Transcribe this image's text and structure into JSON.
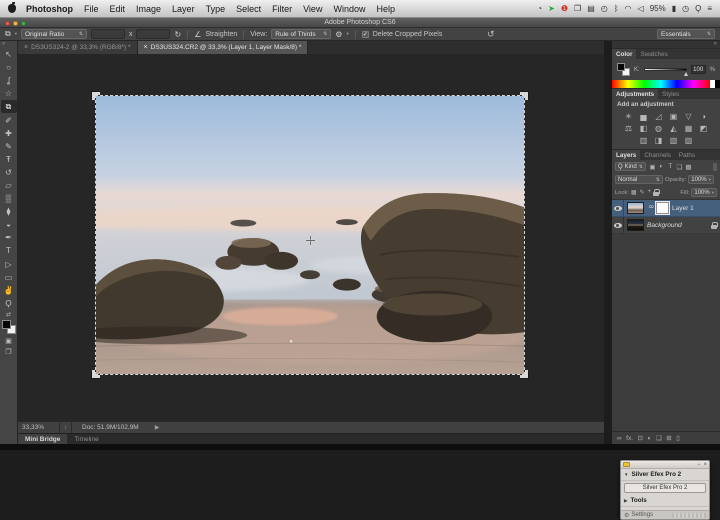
{
  "colors": {
    "selection_blue": "#44607c",
    "badge_red": "#cf3126",
    "vpn_green": "#23a63c",
    "traffic_red": "#f25c54",
    "traffic_yellow": "#f8bd44",
    "traffic_green": "#3fb94f"
  },
  "menubar": {
    "items": [
      {
        "label": "Photoshop",
        "active": true
      },
      {
        "label": "File"
      },
      {
        "label": "Edit"
      },
      {
        "label": "Image"
      },
      {
        "label": "Layer"
      },
      {
        "label": "Type"
      },
      {
        "label": "Select"
      },
      {
        "label": "Filter"
      },
      {
        "label": "View"
      },
      {
        "label": "Window"
      },
      {
        "label": "Help"
      }
    ],
    "status_icons": [
      {
        "name": "compass-icon",
        "glyph": "◔"
      },
      {
        "name": "vpn-arrow-icon",
        "glyph": "➤",
        "color": "#23a63c"
      },
      {
        "name": "update-badge-icon",
        "glyph": "❶",
        "color": "#cf3126"
      },
      {
        "name": "stack-icon",
        "glyph": "❐"
      },
      {
        "name": "display-icon",
        "glyph": "▤"
      },
      {
        "name": "time-machine-icon",
        "glyph": "◴"
      },
      {
        "name": "bluetooth-icon",
        "glyph": "ᛒ"
      },
      {
        "name": "wifi-icon",
        "glyph": "◠"
      },
      {
        "name": "volume-icon",
        "glyph": "◁"
      },
      {
        "name": "battery-percent-label",
        "glyph": "95%"
      },
      {
        "name": "battery-icon",
        "glyph": "▮"
      },
      {
        "name": "clock-icon",
        "glyph": "◷"
      },
      {
        "name": "spotlight-icon",
        "glyph": "Ϙ"
      },
      {
        "name": "notification-list-icon",
        "glyph": "≡"
      }
    ]
  },
  "titlebar": {
    "title": "Adobe Photoshop CS6"
  },
  "options": {
    "crop_icon": "⧉",
    "ratio_value": "Original Ratio",
    "x_label": "x",
    "swap_icon": "↻",
    "straighten_icon": "∠",
    "straighten_label": "Straighten",
    "view_label": "View:",
    "view_value": "Rule of Thirds",
    "gear_icon": "⚙",
    "delete_label": "Delete Cropped Pixels",
    "check_glyph": "✓",
    "reset_icon": "↺",
    "workspace_value": "Essentials"
  },
  "dock_collapse_icon": "»",
  "doc_tabs": [
    {
      "label": "DS3US324-2 @ 33,3% (RGB/8*) *"
    },
    {
      "label": "DS3US324.CR2 @ 33,3% (Layer 1, Layer Mask/8) *",
      "active": true
    }
  ],
  "tab_close_icon": "×",
  "tools": [
    {
      "name": "move-tool",
      "glyph": "↖"
    },
    {
      "name": "marquee-tool",
      "glyph": "○"
    },
    {
      "name": "lasso-tool",
      "glyph": "ʆ"
    },
    {
      "name": "magic-wand-tool",
      "glyph": "☆"
    },
    {
      "name": "crop-tool",
      "glyph": "⧉",
      "active": true
    },
    {
      "name": "eyedropper-tool",
      "glyph": "✐"
    },
    {
      "name": "healing-brush-tool",
      "glyph": "✚"
    },
    {
      "name": "brush-tool",
      "glyph": "✎"
    },
    {
      "name": "clone-stamp-tool",
      "glyph": "Ŧ"
    },
    {
      "name": "history-brush-tool",
      "glyph": "↺"
    },
    {
      "name": "eraser-tool",
      "glyph": "▱"
    },
    {
      "name": "gradient-tool",
      "glyph": "▒"
    },
    {
      "name": "blur-tool",
      "glyph": "⧫"
    },
    {
      "name": "dodge-tool",
      "glyph": "◒"
    },
    {
      "name": "pen-tool",
      "glyph": "✒"
    },
    {
      "name": "type-tool",
      "glyph": "T"
    },
    {
      "name": "path-selection-tool",
      "glyph": "▷"
    },
    {
      "name": "shape-tool",
      "glyph": "▭"
    },
    {
      "name": "hand-tool",
      "glyph": "✌"
    },
    {
      "name": "zoom-tool",
      "glyph": "Ϙ"
    }
  ],
  "tools_extra": {
    "swap_icon": "⇄",
    "quick_mask_icon": "▣",
    "screen_mode_icon": "❐"
  },
  "color_panel": {
    "tabs": [
      {
        "label": "Color",
        "active": true
      },
      {
        "label": "Swatches"
      }
    ],
    "k_label": "K:",
    "k_value": "100",
    "percent_label": "%"
  },
  "adjustments_panel": {
    "tabs": [
      {
        "label": "Adjustments",
        "active": true
      },
      {
        "label": "Styles"
      }
    ],
    "heading": "Add an adjustment",
    "icons": [
      {
        "name": "brightness-contrast-icon",
        "glyph": "☀"
      },
      {
        "name": "levels-icon",
        "glyph": "▅"
      },
      {
        "name": "curves-icon",
        "glyph": "◿"
      },
      {
        "name": "exposure-icon",
        "glyph": "▣"
      },
      {
        "name": "vibrance-icon",
        "glyph": "▽"
      },
      {
        "name": "hue-saturation-icon",
        "glyph": "◑"
      },
      {
        "name": "color-balance-icon",
        "glyph": "⚖"
      },
      {
        "name": "black-white-icon",
        "glyph": "◧"
      },
      {
        "name": "photo-filter-icon",
        "glyph": "◍"
      },
      {
        "name": "channel-mixer-icon",
        "glyph": "◭"
      },
      {
        "name": "color-lookup-icon",
        "glyph": "▦"
      },
      {
        "name": "invert-icon",
        "glyph": "◩"
      },
      {
        "name": "posterize-icon",
        "glyph": "▥"
      },
      {
        "name": "threshold-icon",
        "glyph": "◨"
      },
      {
        "name": "selective-color-icon",
        "glyph": "▧"
      },
      {
        "name": "gradient-map-icon",
        "glyph": "▨"
      }
    ]
  },
  "layers_panel": {
    "tabs": [
      {
        "label": "Layers",
        "active": true
      },
      {
        "label": "Channels"
      },
      {
        "label": "Paths"
      }
    ],
    "search_icon": "Ϙ",
    "filter_label": "Kind",
    "filter_icons": [
      {
        "name": "filter-pixel-layers-icon",
        "glyph": "▣"
      },
      {
        "name": "filter-adjustment-layers-icon",
        "glyph": "◐"
      },
      {
        "name": "filter-type-layers-icon",
        "glyph": "T"
      },
      {
        "name": "filter-group-layers-icon",
        "glyph": "❏"
      },
      {
        "name": "filter-smart-object-icon",
        "glyph": "▩"
      }
    ],
    "blend_mode": "Normal",
    "opacity_label": "Opacity:",
    "opacity_value": "100%",
    "lock_label": "Lock:",
    "lock_icons": [
      {
        "name": "lock-transparency-icon",
        "glyph": "▦"
      },
      {
        "name": "lock-pixels-icon",
        "glyph": "✎"
      },
      {
        "name": "lock-position-icon",
        "glyph": "+"
      }
    ],
    "fill_label": "Fill:",
    "fill_value": "100%",
    "layer1_name": "Layer 1",
    "link_glyph": "8",
    "background_name": "Background",
    "bottom_icons": [
      {
        "name": "link-layers-icon",
        "glyph": "∞"
      },
      {
        "name": "layer-effects-icon",
        "glyph": "fx."
      },
      {
        "name": "add-layer-mask-icon",
        "glyph": "⊡"
      },
      {
        "name": "new-adjustment-layer-icon",
        "glyph": "◐"
      },
      {
        "name": "new-group-icon",
        "glyph": "❏"
      },
      {
        "name": "new-layer-icon",
        "glyph": "⊞"
      },
      {
        "name": "delete-layer-icon",
        "glyph": "▯"
      }
    ]
  },
  "efex": {
    "title": "Silver Efex Pro 2",
    "button_label": "Silver Efex Pro 2",
    "tools_label": "Tools",
    "settings_label": "Settings",
    "minimize_icon": "−",
    "close_icon": "×",
    "expand_caret": "▼",
    "collapsed_caret": "▶",
    "gear_icon": "⚙"
  },
  "statusbar": {
    "zoom_value": "33,33%",
    "scrub_icon": "↕",
    "doc_label": "Doc: 51,9M/102,9M",
    "flyout_icon": "▶"
  },
  "bottom_tabs": [
    {
      "label": "Mini Bridge",
      "active": true
    },
    {
      "label": "Timeline"
    }
  ]
}
